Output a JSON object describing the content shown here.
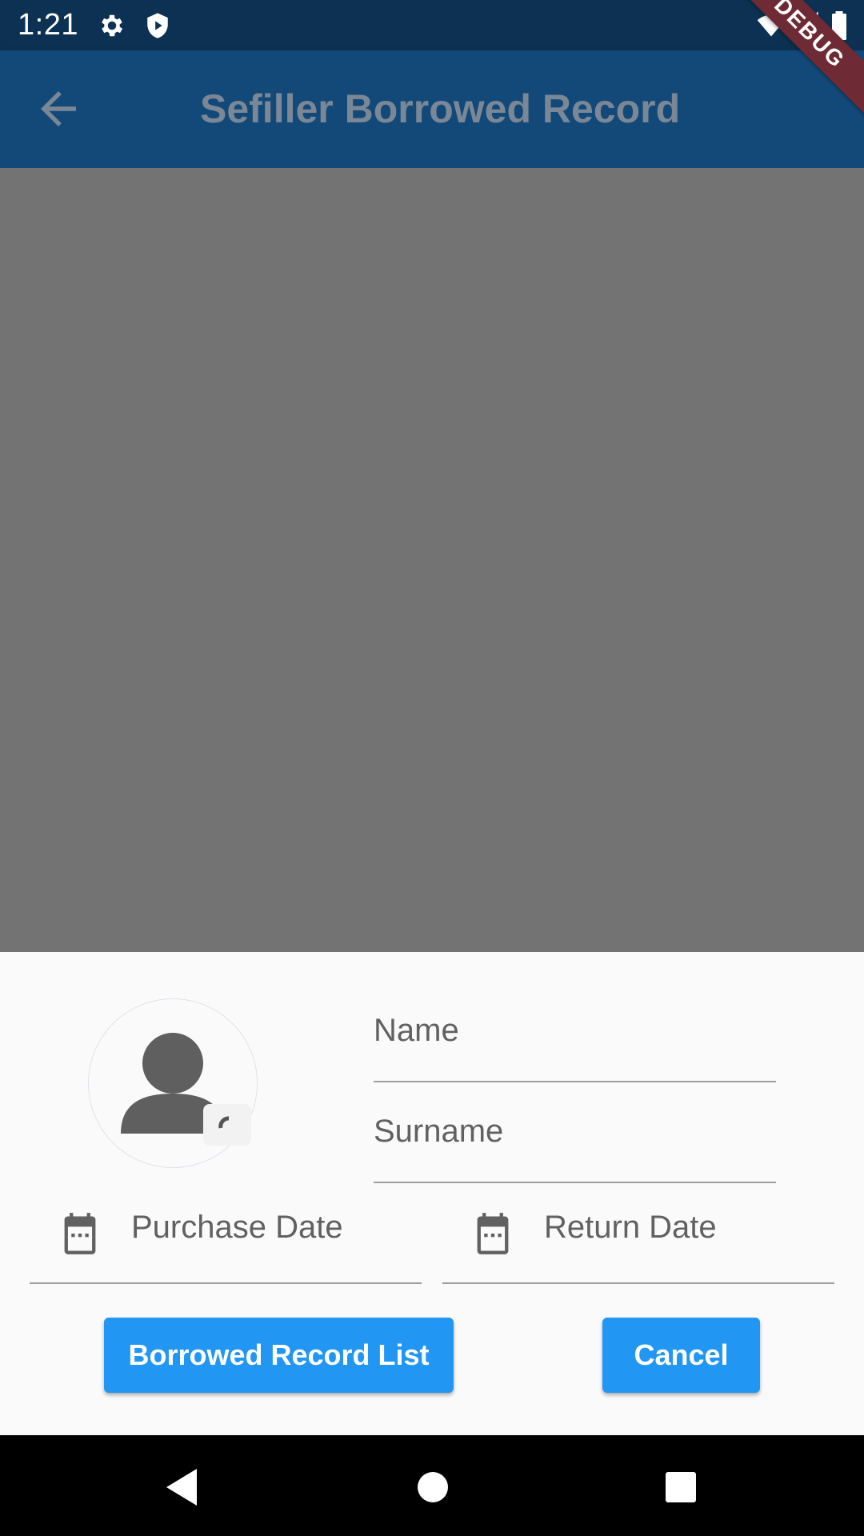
{
  "status_bar": {
    "time": "1:21",
    "left_icons": [
      "gear-icon",
      "shield-icon"
    ],
    "right_icons": [
      "wifi-icon",
      "signal-icon",
      "battery-icon"
    ]
  },
  "app_bar": {
    "title": "Sefiller Borrowed Record",
    "back_icon": "arrow-left-icon",
    "debug_banner": "DEBUG"
  },
  "form": {
    "avatar_icon": "person-icon",
    "camera_icon": "camera-icon",
    "name_placeholder": "Name",
    "surname_placeholder": "Surname",
    "purchase_date_placeholder": "Purchase Date",
    "return_date_placeholder": "Return Date",
    "date_icon": "calendar-icon"
  },
  "actions": {
    "list_label": "Borrowed Record List",
    "cancel_label": "Cancel"
  },
  "nav_bar": {
    "icons": [
      "back-triangle-icon",
      "home-circle-icon",
      "recents-square-icon"
    ]
  },
  "colors": {
    "status_bar": "#0c3152",
    "app_bar": "#124979",
    "scrim": "#737373",
    "sheet": "#fafafa",
    "button": "#2196f3",
    "debug_ribbon": "#6e2a35"
  }
}
